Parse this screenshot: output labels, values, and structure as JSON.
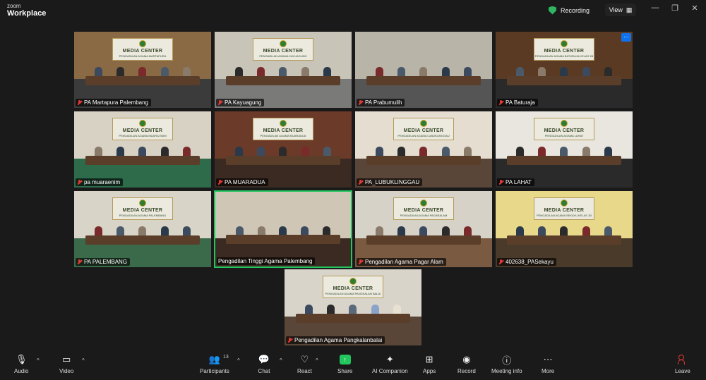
{
  "app": {
    "brand_line1": "zoom",
    "brand_line2": "Workplace"
  },
  "header": {
    "recording_label": "Recording",
    "view_label": "View"
  },
  "window_controls": {
    "minimize": "—",
    "restore": "❐",
    "close": "✕"
  },
  "tiles": [
    {
      "name": "PA Martapura Palembang",
      "banner": "MEDIA CENTER",
      "sub": "PENGADILAN AGAMA MARTAPURA",
      "wall": "#8a6a45",
      "floor": "#3b3b3b",
      "muted": true
    },
    {
      "name": "PA Kayuagung",
      "banner": "MEDIA CENTER",
      "sub": "PENGADILAN AGAMA KAYUAGUNG",
      "wall": "#c8c4b8",
      "floor": "#7a7a78",
      "muted": true
    },
    {
      "name": "PA Prabumulih",
      "banner": "",
      "sub": "",
      "wall": "#b9b4a8",
      "floor": "#555555",
      "muted": true
    },
    {
      "name": "PA Baturaja",
      "banner": "MEDIA CENTER",
      "sub": "PENGADILAN AGAMA BATURAJA KELAS 1B",
      "wall": "#5a3a22",
      "floor": "#2a2a2a",
      "muted": true
    },
    {
      "name": "pa muaraenim",
      "banner": "MEDIA CENTER",
      "sub": "PENGADILAN AGAMA MUARA ENIM",
      "wall": "#d8d2c4",
      "floor": "#2d6b4a",
      "muted": true
    },
    {
      "name": "PA MUARADUA",
      "banner": "MEDIA CENTER",
      "sub": "PENGADILAN AGAMA MUARADUA",
      "wall": "#6b3a28",
      "floor": "#3a2a22",
      "muted": true
    },
    {
      "name": "PA_LUBUKLINGGAU",
      "banner": "MEDIA CENTER",
      "sub": "PENGADILAN AGAMA LUBUKLINGGAU",
      "wall": "#e4ddd0",
      "floor": "#5a4638",
      "muted": true
    },
    {
      "name": "PA LAHAT",
      "banner": "MEDIA CENTER",
      "sub": "PENGADILAN AGAMA LAHAT",
      "wall": "#e8e6df",
      "floor": "#2a2a2a",
      "muted": true
    },
    {
      "name": "PA PALEMBANG",
      "banner": "MEDIA CENTER",
      "sub": "PENGADILAN AGAMA PALEMBANG",
      "wall": "#d9d4c8",
      "floor": "#3a6a4a",
      "muted": true
    },
    {
      "name": "Pengadilan Tinggi Agama Palembang",
      "banner": "",
      "sub": "",
      "wall": "#cfc6b6",
      "floor": "#3a2a22",
      "muted": false
    },
    {
      "name": "Pengadilan Agama Pagar Alam",
      "banner": "MEDIA CENTER",
      "sub": "PENGADILAN AGAMA PAGARALAM",
      "wall": "#d6d2c8",
      "floor": "#7a5a40",
      "muted": true
    },
    {
      "name": "402638_PASekayu",
      "banner": "MEDIA CENTER",
      "sub": "PENGADILAN AGAMA SEKAYU KELAS 1B",
      "wall": "#e8d88a",
      "floor": "#4a3a2a",
      "muted": true
    }
  ],
  "bottom_tile": {
    "name": "Pengadilan Agama Pangkalanbalai",
    "banner": "MEDIA CENTER",
    "sub": "PENGADILAN AGAMA PANGKALAN BALAI",
    "wall": "#d8d4ca",
    "floor": "#5a4638"
  },
  "toolbar": {
    "audio": "Audio",
    "video": "Video",
    "participants": "Participants",
    "participants_count": "13",
    "chat": "Chat",
    "react": "React",
    "share": "Share",
    "ai_companion": "AI Companion",
    "apps": "Apps",
    "record": "Record",
    "meeting_info": "Meeting info",
    "more": "More",
    "leave": "Leave"
  },
  "colors": {
    "active_speaker": "#22c55e",
    "muted_icon": "#e53935",
    "share": "#22c55e",
    "leave": "#e53935"
  }
}
